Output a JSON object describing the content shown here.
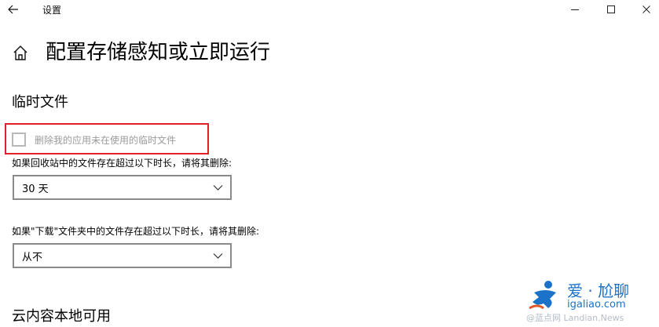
{
  "window": {
    "back_icon": "back-arrow-icon",
    "title": "设置",
    "minimize_icon": "minimize-icon",
    "maximize_icon": "maximize-icon",
    "close_icon": "close-icon"
  },
  "header": {
    "home_icon": "home-icon",
    "title": "配置存储感知或立即运行"
  },
  "temp_files": {
    "heading": "临时文件",
    "delete_unused_checkbox": {
      "label": "删除我的应用未在使用的临时文件",
      "checked": false,
      "enabled": false,
      "highlighted": true,
      "highlight_color": "#e0202a"
    },
    "recycle_bin": {
      "label": "如果回收站中的文件存在超过以下时长，请将其删除:",
      "value": "30 天"
    },
    "downloads": {
      "label": "如果\"下载\"文件夹中的文件存在超过以下时长，请将其删除:",
      "value": "从不"
    }
  },
  "cloud": {
    "heading": "云内容本地可用"
  },
  "watermark": {
    "brand": "爱 · 尬聊",
    "url": "igaliao.com",
    "news": "@蓝点网 Landian.News"
  }
}
